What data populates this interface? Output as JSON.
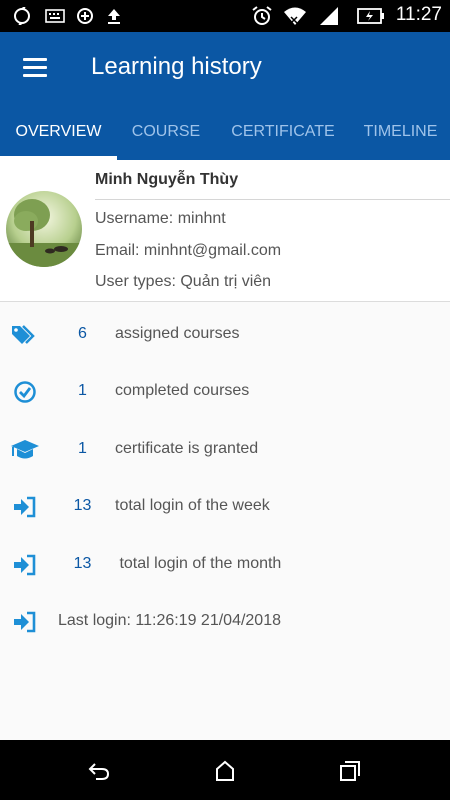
{
  "status_bar": {
    "time": "11:27",
    "icons": [
      "sync-icon",
      "keyboard-icon",
      "data-saver-icon",
      "upload-icon",
      "alarm-icon",
      "wifi-icon",
      "signal-icon",
      "battery-charging-icon"
    ]
  },
  "app_bar": {
    "title": "Learning history"
  },
  "tabs": [
    {
      "label": "OVERVIEW",
      "active": true
    },
    {
      "label": "COURSE",
      "active": false
    },
    {
      "label": "CERTIFICATE",
      "active": false
    },
    {
      "label": "TIMELINE",
      "active": false
    }
  ],
  "profile": {
    "name": "Minh Nguyễn Thùy",
    "username": "Username: minhnt",
    "email": "Email: minhnt@gmail.com",
    "user_type": "User types: Quản trị viên"
  },
  "stats": [
    {
      "icon": "tags-icon",
      "value": "6",
      "label": "assigned courses"
    },
    {
      "icon": "check-circle-icon",
      "value": "1",
      "label": "completed courses"
    },
    {
      "icon": "graduation-cap-icon",
      "value": "1",
      "label": "certificate is granted"
    },
    {
      "icon": "login-icon",
      "value": "13",
      "label": "total login of the week"
    },
    {
      "icon": "login-icon",
      "value": "13",
      "label": " total login of the month"
    }
  ],
  "last_login": {
    "icon": "login-icon",
    "text": "Last login: 11:26:19 21/04/2018"
  },
  "colors": {
    "primary": "#0b57a4",
    "accent_icon": "#1e8fd6",
    "text": "#555555"
  }
}
